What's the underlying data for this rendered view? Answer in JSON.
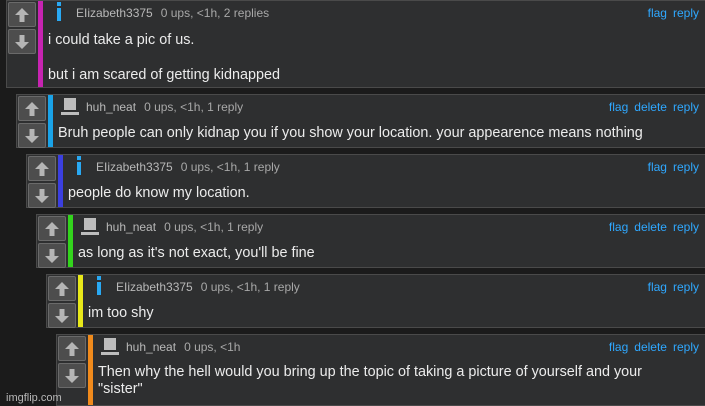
{
  "comments": [
    {
      "avatar": "info-avatar-icon",
      "username": "EIizabeth3375",
      "stats": "0 ups, <1h, 2 replies",
      "actions": [
        "flag",
        "reply"
      ],
      "text": [
        "i could take a pic of us.",
        "but i am scared of getting kidnapped"
      ],
      "bar_color": "#c724b1"
    },
    {
      "avatar": "user-avatar-icon",
      "username": "huh_neat",
      "stats": "0 ups, <1h, 1 reply",
      "actions": [
        "flag",
        "delete",
        "reply"
      ],
      "text": [
        "Bruh people can only kidnap you if you show your location. your appearence means nothing"
      ],
      "bar_color": "#1aa3e8"
    },
    {
      "avatar": "info-avatar-icon",
      "username": "EIizabeth3375",
      "stats": "0 ups, <1h, 1 reply",
      "actions": [
        "flag",
        "reply"
      ],
      "text": [
        "people do know my location."
      ],
      "bar_color": "#3b3fe0"
    },
    {
      "avatar": "user-avatar-icon",
      "username": "huh_neat",
      "stats": "0 ups, <1h, 1 reply",
      "actions": [
        "flag",
        "delete",
        "reply"
      ],
      "text": [
        "as long as it's not exact, you'll be fine"
      ],
      "bar_color": "#33d41d"
    },
    {
      "avatar": "info-avatar-icon",
      "username": "EIizabeth3375",
      "stats": "0 ups, <1h, 1 reply",
      "actions": [
        "flag",
        "reply"
      ],
      "text": [
        "im too shy"
      ],
      "bar_color": "#e8e81a"
    },
    {
      "avatar": "user-avatar-icon",
      "username": "huh_neat",
      "stats": "0 ups, <1h",
      "actions": [
        "flag",
        "delete",
        "reply"
      ],
      "text": [
        "Then why the hell would you bring up the topic of taking a picture of yourself and your \"sister\""
      ],
      "bar_color": "#f08a1c"
    }
  ],
  "watermark": "imgflip.com",
  "icons": {
    "upvote": "up-arrow-icon",
    "downvote": "down-arrow-icon"
  }
}
